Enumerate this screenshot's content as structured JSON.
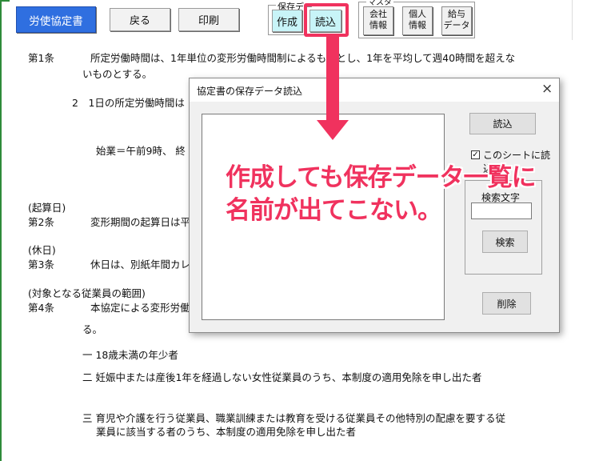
{
  "toolbar": {
    "title_button": "労使協定書",
    "back_button": "戻る",
    "print_button": "印刷",
    "save_group_label": "保存デー",
    "create_button": "作成",
    "load_button": "読込",
    "master_group_label": "マスタ",
    "company_info": [
      "会社",
      "情報"
    ],
    "personal_info": [
      "個人",
      "情報"
    ],
    "salary_data": [
      "給与",
      "データ"
    ]
  },
  "document": {
    "art1_num": "第1条",
    "art1_text": "所定労働時間は、1年単位の変形労働時間制によるものとし、1年を平均して週40時間を超えな",
    "art1_text2": "いものとする。",
    "p2": "2　1日の所定労働時間は",
    "start_time": "始業＝午前9時、 終",
    "h_kisan": "(起算日)",
    "art2_num": "第2条",
    "art2_text": "変形期間の起算日は平",
    "h_kyujitsu": "(休日)",
    "art3_num": "第3条",
    "art3_text": "休日は、別紙年間カレ",
    "h_taisho": "(対象となる従業員の範囲)",
    "art4_num": "第4条",
    "art4_text": "本協定による変形労働",
    "art4_text2": "る。",
    "item1": "一 18歳未満の年少者",
    "item2": "二 妊娠中または産後1年を経過しない女性従業員のうち、本制度の適用免除を申し出た者",
    "item3": "三 育児や介護を行う従業員、職業訓練または教育を受ける従業員その他特別の配慮を要する従",
    "item3b": "業員に該当する者のうち、本制度の適用免除を申し出た者"
  },
  "dialog": {
    "title": "協定書の保存データ読込",
    "close": "×",
    "load_button": "読込",
    "checkbox_label": "このシートに読込",
    "checkbox_checked": true,
    "search_label": "検索文字",
    "search_value": "",
    "search_button": "検索",
    "delete_button": "削除",
    "list_items": []
  },
  "annotation": {
    "line1": "作成しても保存データ一覧に",
    "line2": "名前が出てこない。",
    "color": "#f0325e"
  }
}
